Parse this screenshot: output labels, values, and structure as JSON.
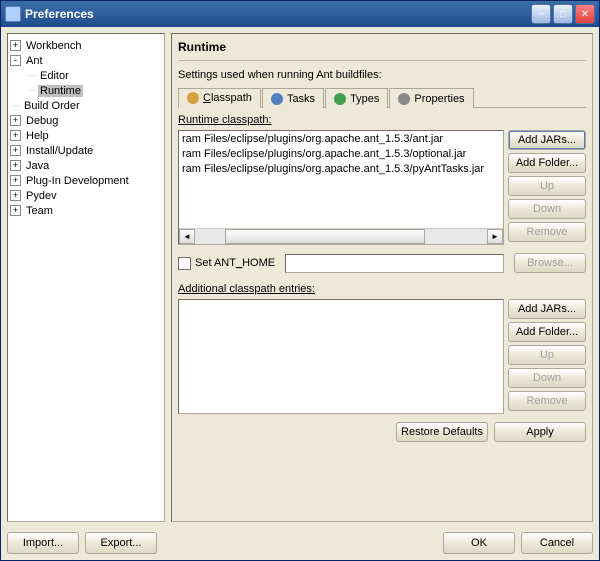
{
  "window": {
    "title": "Preferences"
  },
  "tree": {
    "items": [
      {
        "label": "Workbench",
        "expand": "+",
        "indent": 0
      },
      {
        "label": "Ant",
        "expand": "-",
        "indent": 0
      },
      {
        "label": "Editor",
        "expand": "",
        "indent": 1,
        "line": true
      },
      {
        "label": "Runtime",
        "expand": "",
        "indent": 1,
        "line": true,
        "selected": true
      },
      {
        "label": "Build Order",
        "expand": "",
        "indent": 0,
        "line": true
      },
      {
        "label": "Debug",
        "expand": "+",
        "indent": 0
      },
      {
        "label": "Help",
        "expand": "+",
        "indent": 0
      },
      {
        "label": "Install/Update",
        "expand": "+",
        "indent": 0
      },
      {
        "label": "Java",
        "expand": "+",
        "indent": 0
      },
      {
        "label": "Plug-In Development",
        "expand": "+",
        "indent": 0
      },
      {
        "label": "Pydev",
        "expand": "+",
        "indent": 0
      },
      {
        "label": "Team",
        "expand": "+",
        "indent": 0
      }
    ]
  },
  "page": {
    "title": "Runtime",
    "subtitle": "Settings used when running Ant buildfiles:",
    "tabs": [
      {
        "label": "Classpath",
        "icon_color": "#d4a040"
      },
      {
        "label": "Tasks",
        "icon_color": "#5080c0"
      },
      {
        "label": "Types",
        "icon_color": "#40a050"
      },
      {
        "label": "Properties",
        "icon_color": "#888"
      }
    ],
    "runtime_label": "Runtime classpath:",
    "runtime_items": [
      "ram Files/eclipse/plugins/org.apache.ant_1.5.3/ant.jar",
      "ram Files/eclipse/plugins/org.apache.ant_1.5.3/optional.jar",
      "ram Files/eclipse/plugins/org.apache.ant_1.5.3/pyAntTasks.jar"
    ],
    "buttons1": {
      "add_jars": "Add JARs...",
      "add_folder": "Add Folder...",
      "up": "Up",
      "down": "Down",
      "remove": "Remove"
    },
    "set_ant_home": "Set ANT_HOME",
    "browse": "Browse...",
    "additional_label": "Additional classpath entries:",
    "buttons2": {
      "add_jars": "Add JARs...",
      "add_folder": "Add Folder...",
      "up": "Up",
      "down": "Down",
      "remove": "Remove"
    },
    "restore": "Restore Defaults",
    "apply": "Apply"
  },
  "footer": {
    "import": "Import...",
    "export": "Export...",
    "ok": "OK",
    "cancel": "Cancel"
  }
}
